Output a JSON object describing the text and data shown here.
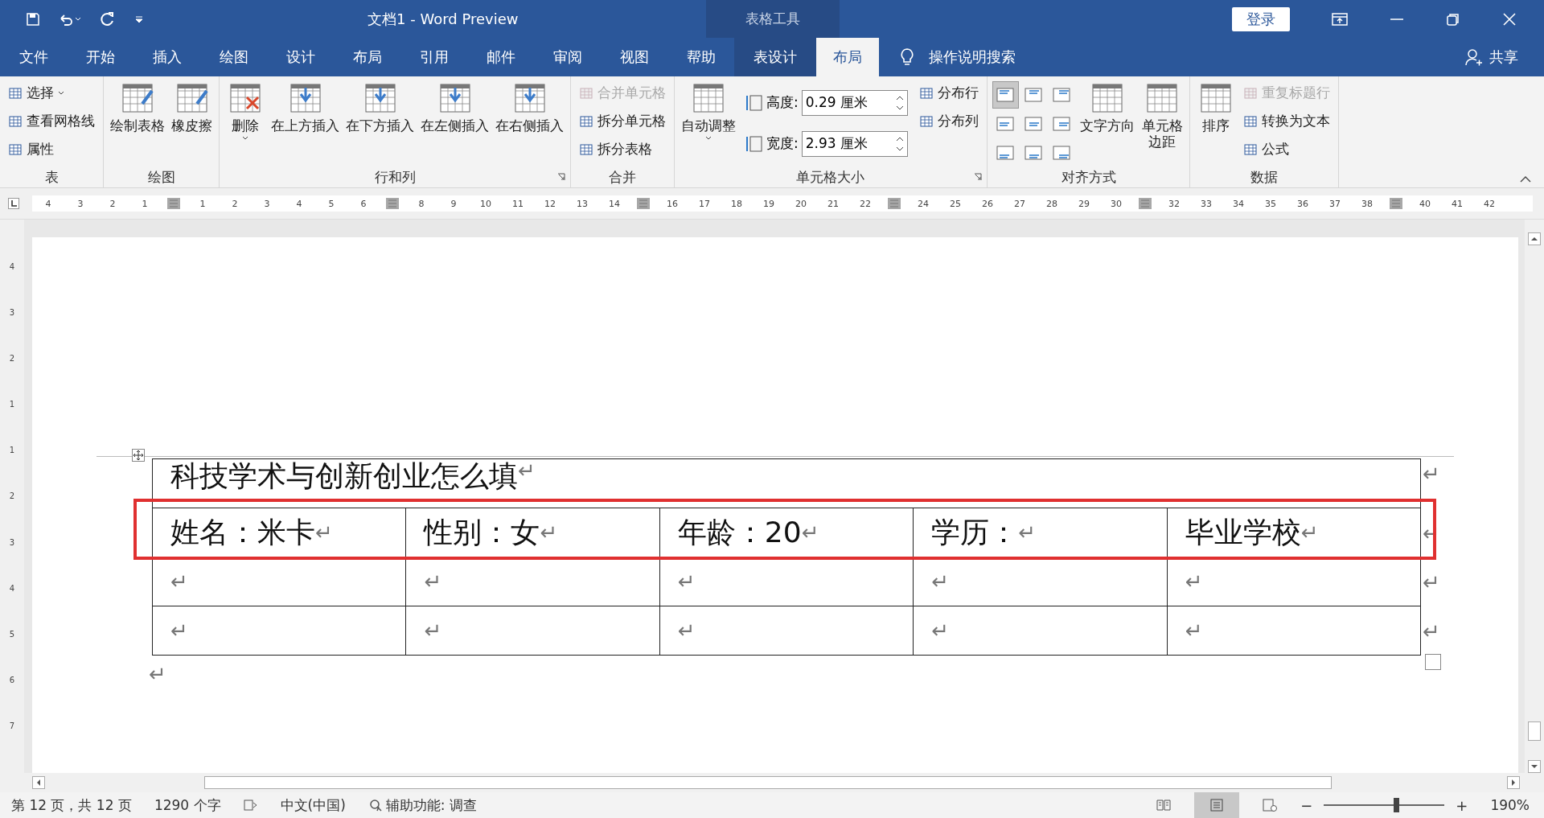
{
  "title_bar": {
    "title": "文档1  -  Word Preview",
    "context_label": "表格工具",
    "signin": "登录"
  },
  "tabs": [
    {
      "label": "文件",
      "selected": false
    },
    {
      "label": "开始",
      "selected": false
    },
    {
      "label": "插入",
      "selected": false
    },
    {
      "label": "绘图",
      "selected": false
    },
    {
      "label": "设计",
      "selected": false
    },
    {
      "label": "布局",
      "selected": false
    },
    {
      "label": "引用",
      "selected": false
    },
    {
      "label": "邮件",
      "selected": false
    },
    {
      "label": "审阅",
      "selected": false
    },
    {
      "label": "视图",
      "selected": false
    },
    {
      "label": "帮助",
      "selected": false
    },
    {
      "label": "表设计",
      "selected": false
    },
    {
      "label": "布局",
      "selected": true
    }
  ],
  "tell_me": "操作说明搜索",
  "share": "共享",
  "ribbon": [
    {
      "label": "表",
      "items": [
        {
          "kind": "stack",
          "items": [
            {
              "text": "选择",
              "disabled": false,
              "menu": true
            },
            {
              "text": "查看网格线",
              "disabled": false,
              "menu": false
            },
            {
              "text": "属性",
              "disabled": false,
              "menu": false
            }
          ]
        }
      ]
    },
    {
      "label": "绘图",
      "items": [
        {
          "kind": "large",
          "text": "绘制表格",
          "menu": false
        },
        {
          "kind": "large",
          "text": "橡皮擦",
          "menu": false
        }
      ]
    },
    {
      "label": "行和列",
      "launcher": true,
      "items": [
        {
          "kind": "large",
          "text": "删除",
          "menu": true
        },
        {
          "kind": "large",
          "text": "在上方插入",
          "menu": false
        },
        {
          "kind": "large",
          "text": "在下方插入",
          "menu": false
        },
        {
          "kind": "large",
          "text": "在左侧插入",
          "menu": false
        },
        {
          "kind": "large",
          "text": "在右侧插入",
          "menu": false
        }
      ]
    },
    {
      "label": "合并",
      "items": [
        {
          "kind": "stack",
          "items": [
            {
              "text": "合并单元格",
              "disabled": true,
              "menu": false
            },
            {
              "text": "拆分单元格",
              "disabled": false,
              "menu": false
            },
            {
              "text": "拆分表格",
              "disabled": false,
              "menu": false
            }
          ]
        }
      ]
    },
    {
      "label": "单元格大小",
      "launcher": true,
      "items": [
        {
          "kind": "large",
          "text": "自动调整",
          "menu": true
        },
        {
          "kind": "size",
          "items": [
            {
              "label": "高度:",
              "value": "0.29 厘米"
            },
            {
              "label": "宽度:",
              "value": "2.93 厘米"
            }
          ]
        },
        {
          "kind": "stack",
          "items": [
            {
              "text": "分布行",
              "disabled": false,
              "menu": false
            },
            {
              "text": "分布列",
              "disabled": false,
              "menu": false
            }
          ]
        }
      ]
    },
    {
      "label": "对齐方式",
      "items": [
        {
          "kind": "align",
          "cells": [
            {
              "selected": true
            },
            {
              "selected": false
            },
            {
              "selected": false
            },
            {
              "selected": false
            },
            {
              "selected": false
            },
            {
              "selected": false
            },
            {
              "selected": false
            },
            {
              "selected": false
            },
            {
              "selected": false
            }
          ]
        },
        {
          "kind": "large",
          "text": "文字方向",
          "menu": false
        },
        {
          "kind": "large",
          "text": "单元格边距",
          "menu": false
        }
      ]
    },
    {
      "label": "数据",
      "items": [
        {
          "kind": "large",
          "text": "排序",
          "menu": false
        },
        {
          "kind": "stack",
          "items": [
            {
              "text": "重复标题行",
              "disabled": true,
              "menu": false
            },
            {
              "text": "转换为文本",
              "disabled": false,
              "menu": false
            },
            {
              "text": "公式",
              "disabled": false,
              "menu": false
            }
          ]
        }
      ]
    }
  ],
  "ruler": [
    [
      "4",
      "3",
      "2",
      "1"
    ],
    [
      "1",
      "2",
      "3",
      "4",
      "5",
      "6"
    ],
    [
      "8",
      "9",
      "10",
      "11",
      "12",
      "13",
      "14"
    ],
    [
      "16",
      "17",
      "18",
      "19",
      "20",
      "21",
      "22"
    ],
    [
      "24",
      "25",
      "26",
      "27",
      "28",
      "29",
      "30"
    ],
    [
      "32",
      "33",
      "34",
      "35",
      "36",
      "37",
      "38"
    ],
    [
      "40",
      "41",
      "42"
    ]
  ],
  "vertical_ruler": [
    "4",
    "3",
    "2",
    "1",
    "1",
    "2",
    "3",
    "4",
    "5",
    "6",
    "7"
  ],
  "table": {
    "title": {
      "text": "科技学术与创新创业怎么填",
      "mark": "↵"
    },
    "rows": [
      [
        {
          "text": "姓名：米卡",
          "mark": "↵"
        },
        {
          "text": "性别：女",
          "mark": "↵"
        },
        {
          "text": "年龄：20",
          "mark": "↵"
        },
        {
          "text": "学历：",
          "mark": "↵"
        },
        {
          "text": "毕业学校",
          "mark": "↵"
        }
      ],
      [
        {
          "mark": "↵"
        },
        {
          "mark": "↵"
        },
        {
          "mark": "↵"
        },
        {
          "mark": "↵"
        },
        {
          "mark": "↵"
        }
      ],
      [
        {
          "mark": "↵"
        },
        {
          "mark": "↵"
        },
        {
          "mark": "↵"
        },
        {
          "mark": "↵"
        },
        {
          "mark": "↵"
        }
      ]
    ],
    "row_marks": [
      "↵",
      "↵",
      "↵",
      "↵"
    ],
    "after": "↵"
  },
  "status": {
    "page": "第 12 页，共 12 页",
    "words": "1290 个字",
    "language": "中文(中国)",
    "accessibility": "辅助功能: 调查",
    "zoom": "190%",
    "zoom_out": "−",
    "zoom_in": "+",
    "zoom_level": {
      "level": 0.6
    }
  }
}
